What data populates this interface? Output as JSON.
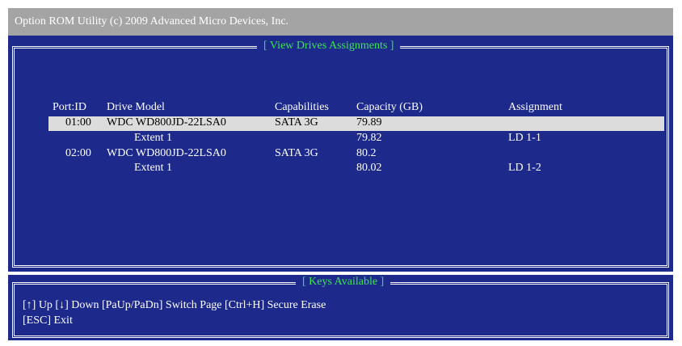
{
  "title": "Option ROM Utility (c) 2009 Advanced Micro Devices, Inc.",
  "main_panel": {
    "title": "[ View Drives Assignments  ]",
    "columns": [
      "Port:ID",
      "Drive Model",
      "Capabilities",
      "Capacity (GB)",
      "Assignment"
    ],
    "rows": [
      {
        "port": "01:00",
        "model": "WDC WD800JD-22LSA0",
        "capabilities": "SATA 3G",
        "capacity": "79.89",
        "assignment": ""
      },
      {
        "port": "",
        "model": "Extent   1",
        "capabilities": "",
        "capacity": "79.82",
        "assignment": "LD    1-1"
      },
      {
        "port": "02:00",
        "model": "WDC WD800JD-22LSA0",
        "capabilities": "SATA 3G",
        "capacity": "80.2",
        "assignment": ""
      },
      {
        "port": "",
        "model": "Extent   1",
        "capabilities": "",
        "capacity": "80.02",
        "assignment": "LD    1-2"
      }
    ]
  },
  "keys_panel": {
    "title": "[ Keys Available ]",
    "line1": "[↑] Up   [↓] Down   [PaUp/PaDn] Switch Page  [Ctrl+H] Secure Erase",
    "line2": "[ESC] Exit"
  },
  "colors": {
    "background": "#1d2a8c",
    "title_bar": "#a4a4a4",
    "frame_title_text": "#39e64a",
    "highlight": "#dcdcdc"
  }
}
